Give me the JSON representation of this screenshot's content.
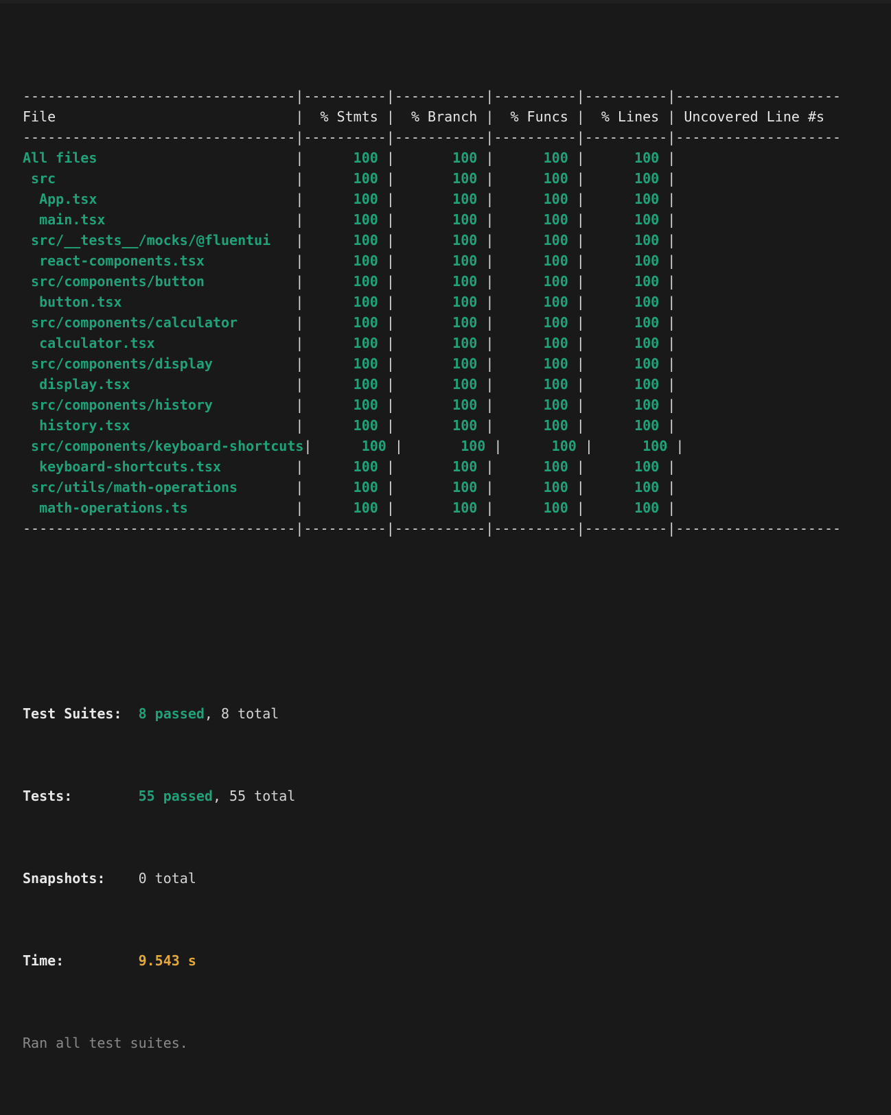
{
  "terminal": {
    "background": "#191919",
    "foreground": "#d4d4d4",
    "accent_green": "#21a179",
    "accent_gold": "#e5a83a",
    "dim": "#8a8a8a"
  },
  "coverage_table": {
    "separator": "----------------------------------|---------|----------|---------|---------|-------------------",
    "columns": [
      {
        "label": "File",
        "align": "left",
        "width": 33
      },
      {
        "label": "% Stmts",
        "align": "right",
        "width": 9
      },
      {
        "label": "% Branch",
        "align": "right",
        "width": 10
      },
      {
        "label": "% Funcs",
        "align": "right",
        "width": 9
      },
      {
        "label": "% Lines",
        "align": "right",
        "width": 9
      },
      {
        "label": "Uncovered Line #s",
        "align": "left",
        "width": 19
      }
    ],
    "rows": [
      {
        "file": "All files",
        "indent": 0,
        "stmts": "100",
        "branch": "100",
        "funcs": "100",
        "lines": "100",
        "uncovered": ""
      },
      {
        "file": "src",
        "indent": 1,
        "stmts": "100",
        "branch": "100",
        "funcs": "100",
        "lines": "100",
        "uncovered": ""
      },
      {
        "file": "App.tsx",
        "indent": 2,
        "stmts": "100",
        "branch": "100",
        "funcs": "100",
        "lines": "100",
        "uncovered": ""
      },
      {
        "file": "main.tsx",
        "indent": 2,
        "stmts": "100",
        "branch": "100",
        "funcs": "100",
        "lines": "100",
        "uncovered": ""
      },
      {
        "file": "src/__tests__/mocks/@fluentui",
        "indent": 1,
        "stmts": "100",
        "branch": "100",
        "funcs": "100",
        "lines": "100",
        "uncovered": ""
      },
      {
        "file": "react-components.tsx",
        "indent": 2,
        "stmts": "100",
        "branch": "100",
        "funcs": "100",
        "lines": "100",
        "uncovered": ""
      },
      {
        "file": "src/components/button",
        "indent": 1,
        "stmts": "100",
        "branch": "100",
        "funcs": "100",
        "lines": "100",
        "uncovered": ""
      },
      {
        "file": "button.tsx",
        "indent": 2,
        "stmts": "100",
        "branch": "100",
        "funcs": "100",
        "lines": "100",
        "uncovered": ""
      },
      {
        "file": "src/components/calculator",
        "indent": 1,
        "stmts": "100",
        "branch": "100",
        "funcs": "100",
        "lines": "100",
        "uncovered": ""
      },
      {
        "file": "calculator.tsx",
        "indent": 2,
        "stmts": "100",
        "branch": "100",
        "funcs": "100",
        "lines": "100",
        "uncovered": ""
      },
      {
        "file": "src/components/display",
        "indent": 1,
        "stmts": "100",
        "branch": "100",
        "funcs": "100",
        "lines": "100",
        "uncovered": ""
      },
      {
        "file": "display.tsx",
        "indent": 2,
        "stmts": "100",
        "branch": "100",
        "funcs": "100",
        "lines": "100",
        "uncovered": ""
      },
      {
        "file": "src/components/history",
        "indent": 1,
        "stmts": "100",
        "branch": "100",
        "funcs": "100",
        "lines": "100",
        "uncovered": ""
      },
      {
        "file": "history.tsx",
        "indent": 2,
        "stmts": "100",
        "branch": "100",
        "funcs": "100",
        "lines": "100",
        "uncovered": ""
      },
      {
        "file": "src/components/keyboard-shortcuts",
        "indent": 1,
        "stmts": "100",
        "branch": "100",
        "funcs": "100",
        "lines": "100",
        "uncovered": ""
      },
      {
        "file": "keyboard-shortcuts.tsx",
        "indent": 2,
        "stmts": "100",
        "branch": "100",
        "funcs": "100",
        "lines": "100",
        "uncovered": ""
      },
      {
        "file": "src/utils/math-operations",
        "indent": 1,
        "stmts": "100",
        "branch": "100",
        "funcs": "100",
        "lines": "100",
        "uncovered": ""
      },
      {
        "file": "math-operations.ts",
        "indent": 2,
        "stmts": "100",
        "branch": "100",
        "funcs": "100",
        "lines": "100",
        "uncovered": ""
      }
    ]
  },
  "summary": {
    "test_suites": {
      "label": "Test Suites:",
      "passed": "8 passed",
      "rest": ", 8 total"
    },
    "tests": {
      "label": "Tests:",
      "passed": "55 passed",
      "rest": ", 55 total"
    },
    "snapshots": {
      "label": "Snapshots:",
      "value": "0 total"
    },
    "time": {
      "label": "Time:",
      "value": "9.543 s"
    },
    "footer": "Ran all test suites."
  }
}
